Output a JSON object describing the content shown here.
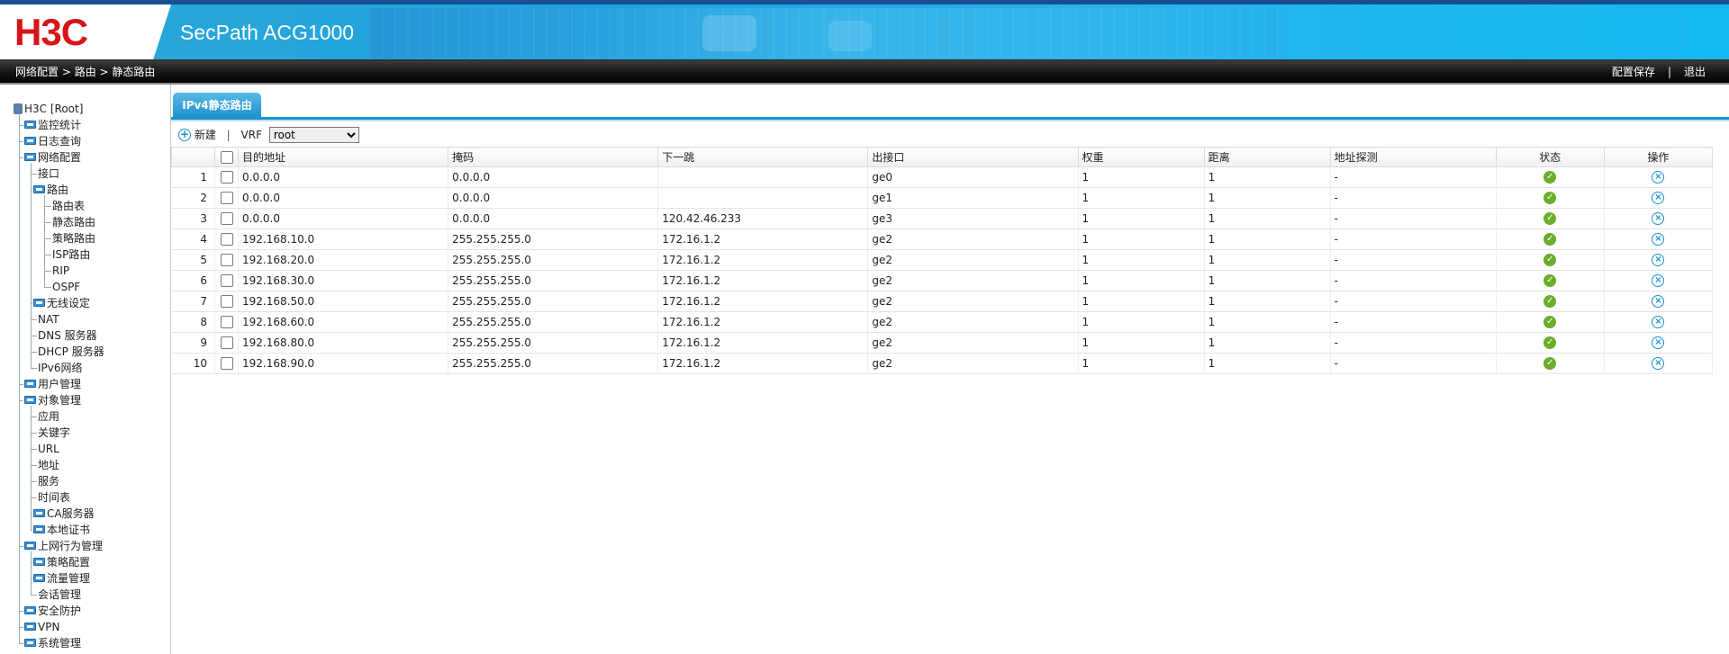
{
  "header": {
    "logo": "H3C",
    "product": "SecPath ACG1000"
  },
  "breadcrumb": [
    "网络配置",
    "路由",
    "静态路由"
  ],
  "breadcrumb_sep": " > ",
  "top_actions": {
    "save": "配置保存",
    "sep": "|",
    "logout": "退出"
  },
  "sidebar": {
    "root": "H3C [Root]",
    "items": [
      {
        "label": "监控统计",
        "level": 1,
        "folder": true
      },
      {
        "label": "日志查询",
        "level": 1,
        "folder": true
      },
      {
        "label": "网络配置",
        "level": 1,
        "folder": true
      },
      {
        "label": "接口",
        "level": 2,
        "folder": false
      },
      {
        "label": "路由",
        "level": 2,
        "folder": true
      },
      {
        "label": "路由表",
        "level": 3,
        "folder": false
      },
      {
        "label": "静态路由",
        "level": 3,
        "folder": false
      },
      {
        "label": "策略路由",
        "level": 3,
        "folder": false
      },
      {
        "label": "ISP路由",
        "level": 3,
        "folder": false
      },
      {
        "label": "RIP",
        "level": 3,
        "folder": false
      },
      {
        "label": "OSPF",
        "level": 3,
        "folder": false
      },
      {
        "label": "无线设定",
        "level": 2,
        "folder": true
      },
      {
        "label": "NAT",
        "level": 2,
        "folder": false
      },
      {
        "label": "DNS 服务器",
        "level": 2,
        "folder": false
      },
      {
        "label": "DHCP 服务器",
        "level": 2,
        "folder": false
      },
      {
        "label": "IPv6网络",
        "level": 2,
        "folder": false
      },
      {
        "label": "用户管理",
        "level": 1,
        "folder": true
      },
      {
        "label": "对象管理",
        "level": 1,
        "folder": true
      },
      {
        "label": "应用",
        "level": 2,
        "folder": false
      },
      {
        "label": "关键字",
        "level": 2,
        "folder": false
      },
      {
        "label": "URL",
        "level": 2,
        "folder": false
      },
      {
        "label": "地址",
        "level": 2,
        "folder": false
      },
      {
        "label": "服务",
        "level": 2,
        "folder": false
      },
      {
        "label": "时间表",
        "level": 2,
        "folder": false
      },
      {
        "label": "CA服务器",
        "level": 2,
        "folder": true
      },
      {
        "label": "本地证书",
        "level": 2,
        "folder": true
      },
      {
        "label": "上网行为管理",
        "level": 1,
        "folder": true
      },
      {
        "label": "策略配置",
        "level": 2,
        "folder": true
      },
      {
        "label": "流量管理",
        "level": 2,
        "folder": true
      },
      {
        "label": "会话管理",
        "level": 2,
        "folder": false
      },
      {
        "label": "安全防护",
        "level": 1,
        "folder": true
      },
      {
        "label": "VPN",
        "level": 1,
        "folder": true
      },
      {
        "label": "系统管理",
        "level": 1,
        "folder": true
      }
    ]
  },
  "tab": {
    "label": "IPv4静态路由"
  },
  "toolbar": {
    "new_label": "新建",
    "sep": "|",
    "vrf_label": "VRF",
    "vrf_value": "root"
  },
  "table": {
    "columns": [
      "目的地址",
      "掩码",
      "下一跳",
      "出接口",
      "权重",
      "距离",
      "地址探测",
      "状态",
      "操作"
    ],
    "rows": [
      {
        "no": "1",
        "dest": "0.0.0.0",
        "mask": "0.0.0.0",
        "nexthop": "",
        "iface": "ge0",
        "weight": "1",
        "distance": "1",
        "probe": "-"
      },
      {
        "no": "2",
        "dest": "0.0.0.0",
        "mask": "0.0.0.0",
        "nexthop": "",
        "iface": "ge1",
        "weight": "1",
        "distance": "1",
        "probe": "-"
      },
      {
        "no": "3",
        "dest": "0.0.0.0",
        "mask": "0.0.0.0",
        "nexthop": "120.42.46.233",
        "iface": "ge3",
        "weight": "1",
        "distance": "1",
        "probe": "-"
      },
      {
        "no": "4",
        "dest": "192.168.10.0",
        "mask": "255.255.255.0",
        "nexthop": "172.16.1.2",
        "iface": "ge2",
        "weight": "1",
        "distance": "1",
        "probe": "-"
      },
      {
        "no": "5",
        "dest": "192.168.20.0",
        "mask": "255.255.255.0",
        "nexthop": "172.16.1.2",
        "iface": "ge2",
        "weight": "1",
        "distance": "1",
        "probe": "-"
      },
      {
        "no": "6",
        "dest": "192.168.30.0",
        "mask": "255.255.255.0",
        "nexthop": "172.16.1.2",
        "iface": "ge2",
        "weight": "1",
        "distance": "1",
        "probe": "-"
      },
      {
        "no": "7",
        "dest": "192.168.50.0",
        "mask": "255.255.255.0",
        "nexthop": "172.16.1.2",
        "iface": "ge2",
        "weight": "1",
        "distance": "1",
        "probe": "-"
      },
      {
        "no": "8",
        "dest": "192.168.60.0",
        "mask": "255.255.255.0",
        "nexthop": "172.16.1.2",
        "iface": "ge2",
        "weight": "1",
        "distance": "1",
        "probe": "-"
      },
      {
        "no": "9",
        "dest": "192.168.80.0",
        "mask": "255.255.255.0",
        "nexthop": "172.16.1.2",
        "iface": "ge2",
        "weight": "1",
        "distance": "1",
        "probe": "-"
      },
      {
        "no": "10",
        "dest": "192.168.90.0",
        "mask": "255.255.255.0",
        "nexthop": "172.16.1.2",
        "iface": "ge2",
        "weight": "1",
        "distance": "1",
        "probe": "-"
      }
    ],
    "status_icon": "check-circle-icon",
    "action_icon": "delete-circle-icon"
  },
  "colors": {
    "brand_red": "#d8141b",
    "header_blue": "#1ca4e0",
    "tab_blue": "#1e91cf",
    "status_green": "#6aae2c"
  }
}
